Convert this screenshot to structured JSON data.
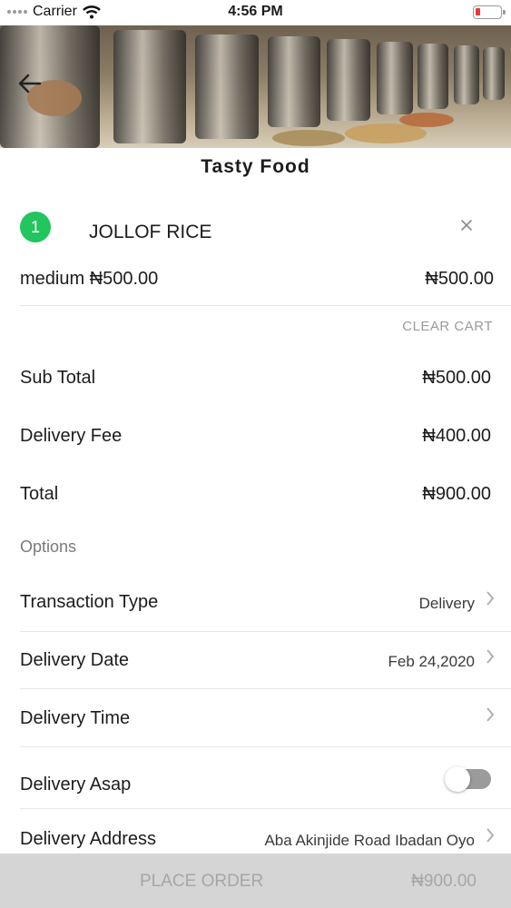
{
  "status_bar": {
    "carrier": "Carrier",
    "time": "4:56 PM"
  },
  "header": {
    "title": "Tasty Food"
  },
  "cart": {
    "items": [
      {
        "quantity": "1",
        "name": "JOLLOF RICE",
        "variant": "medium ₦500.00",
        "price": "₦500.00"
      }
    ],
    "clear_label": "CLEAR CART"
  },
  "summary": {
    "subtotal_label": "Sub Total",
    "subtotal_value": "₦500.00",
    "delivery_fee_label": "Delivery Fee",
    "delivery_fee_value": "₦400.00",
    "total_label": "Total",
    "total_value": "₦900.00"
  },
  "options": {
    "section_label": "Options",
    "transaction_type": {
      "label": "Transaction Type",
      "value": "Delivery"
    },
    "delivery_date": {
      "label": "Delivery Date",
      "value": "Feb 24,2020"
    },
    "delivery_time": {
      "label": "Delivery Time",
      "value": ""
    },
    "delivery_asap": {
      "label": "Delivery Asap",
      "enabled": false
    },
    "delivery_address": {
      "label": "Delivery Address",
      "value": "Aba Akinjide Road Ibadan Oyo"
    }
  },
  "footer": {
    "place_order_label": "PLACE ORDER",
    "total": "₦900.00"
  },
  "colors": {
    "accent_green": "#22c55e",
    "footer_bg": "#d5d5d5",
    "battery_low": "#e53935"
  }
}
